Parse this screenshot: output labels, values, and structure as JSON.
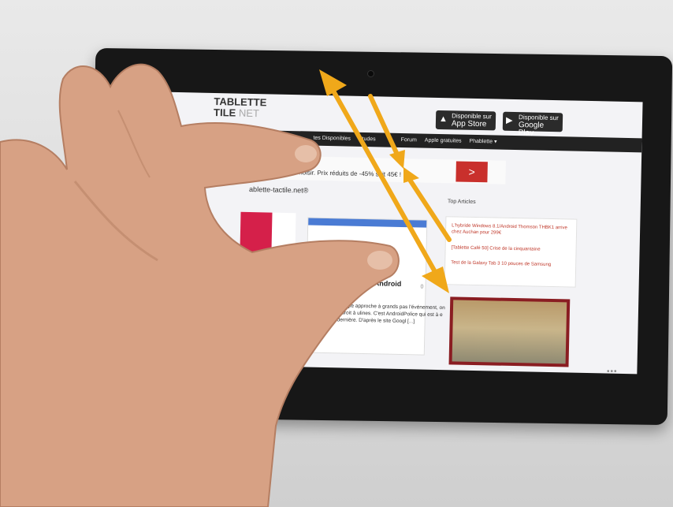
{
  "site": {
    "brand_line1": "TABLETTE",
    "brand_line2a": "TILE",
    "brand_line2b": "NET",
    "site_name": "ablette-tactile.net®"
  },
  "badges": [
    {
      "small": "Disponible sur",
      "big": "App Store",
      "icon": "apple-icon"
    },
    {
      "small": "Disponible sur",
      "big": "Google Play",
      "icon": "google-play-icon"
    }
  ],
  "nav": [
    "tes Disponibles",
    "Etudes",
    "Forum",
    "Apple gratuites",
    "Phablette ▾"
  ],
  "ad": {
    "text": "omparatifs Que Choisir. Prix réduits de -45% soit 45€ !",
    "button": ">"
  },
  "article": {
    "title": "une d'Android",
    "comments": "0",
    "body": "Google approche à grands pas l'événement, on a droit à ulines. C'est AndroidPolice qui est à e dernière. D'après le site Googl [...]"
  },
  "sidebar": {
    "title": "Top Articles",
    "items": [
      "L'hybride Windows 8.1/Android Thomson THBK1 arrive chez Auchan pour 299€",
      "[Tablette Café 50] Crise de la cinquantaine",
      "Test de la Galaxy Tab 3 10 pouces de Samsung"
    ]
  },
  "pager": "•••",
  "colors": {
    "arrow": "#f0a81a",
    "accent_red": "#c9302c",
    "bezel": "#171717",
    "skin": "#d9a487"
  }
}
